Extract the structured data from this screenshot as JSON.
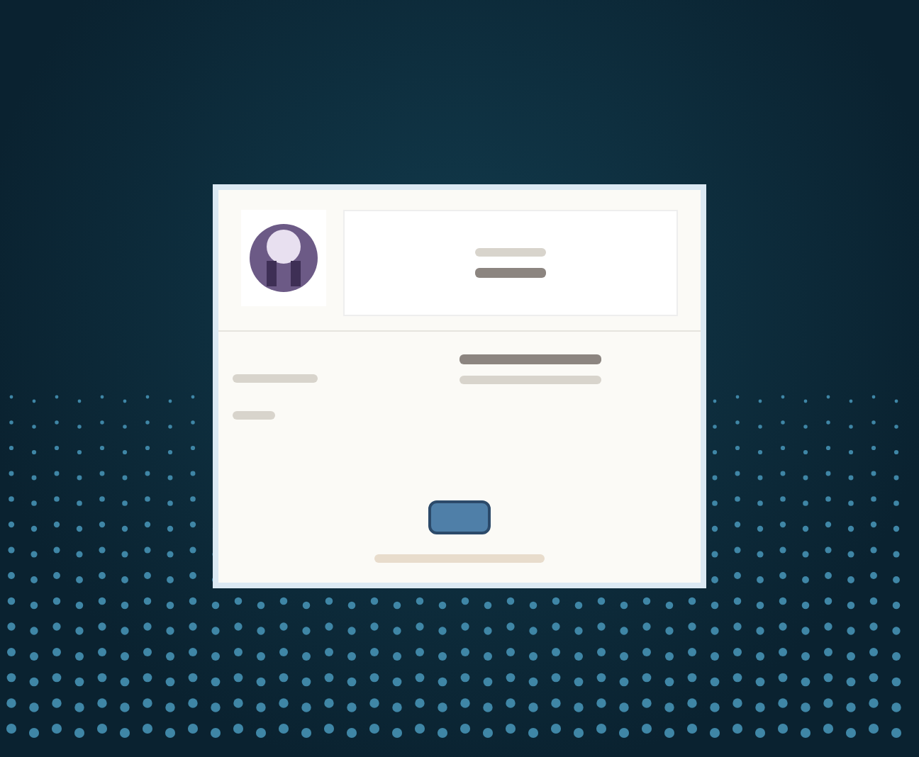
{
  "background": {
    "kind": "dots"
  },
  "dialog": {
    "logo": {
      "kind": "emblem"
    },
    "button": {
      "kind": "primary"
    }
  }
}
